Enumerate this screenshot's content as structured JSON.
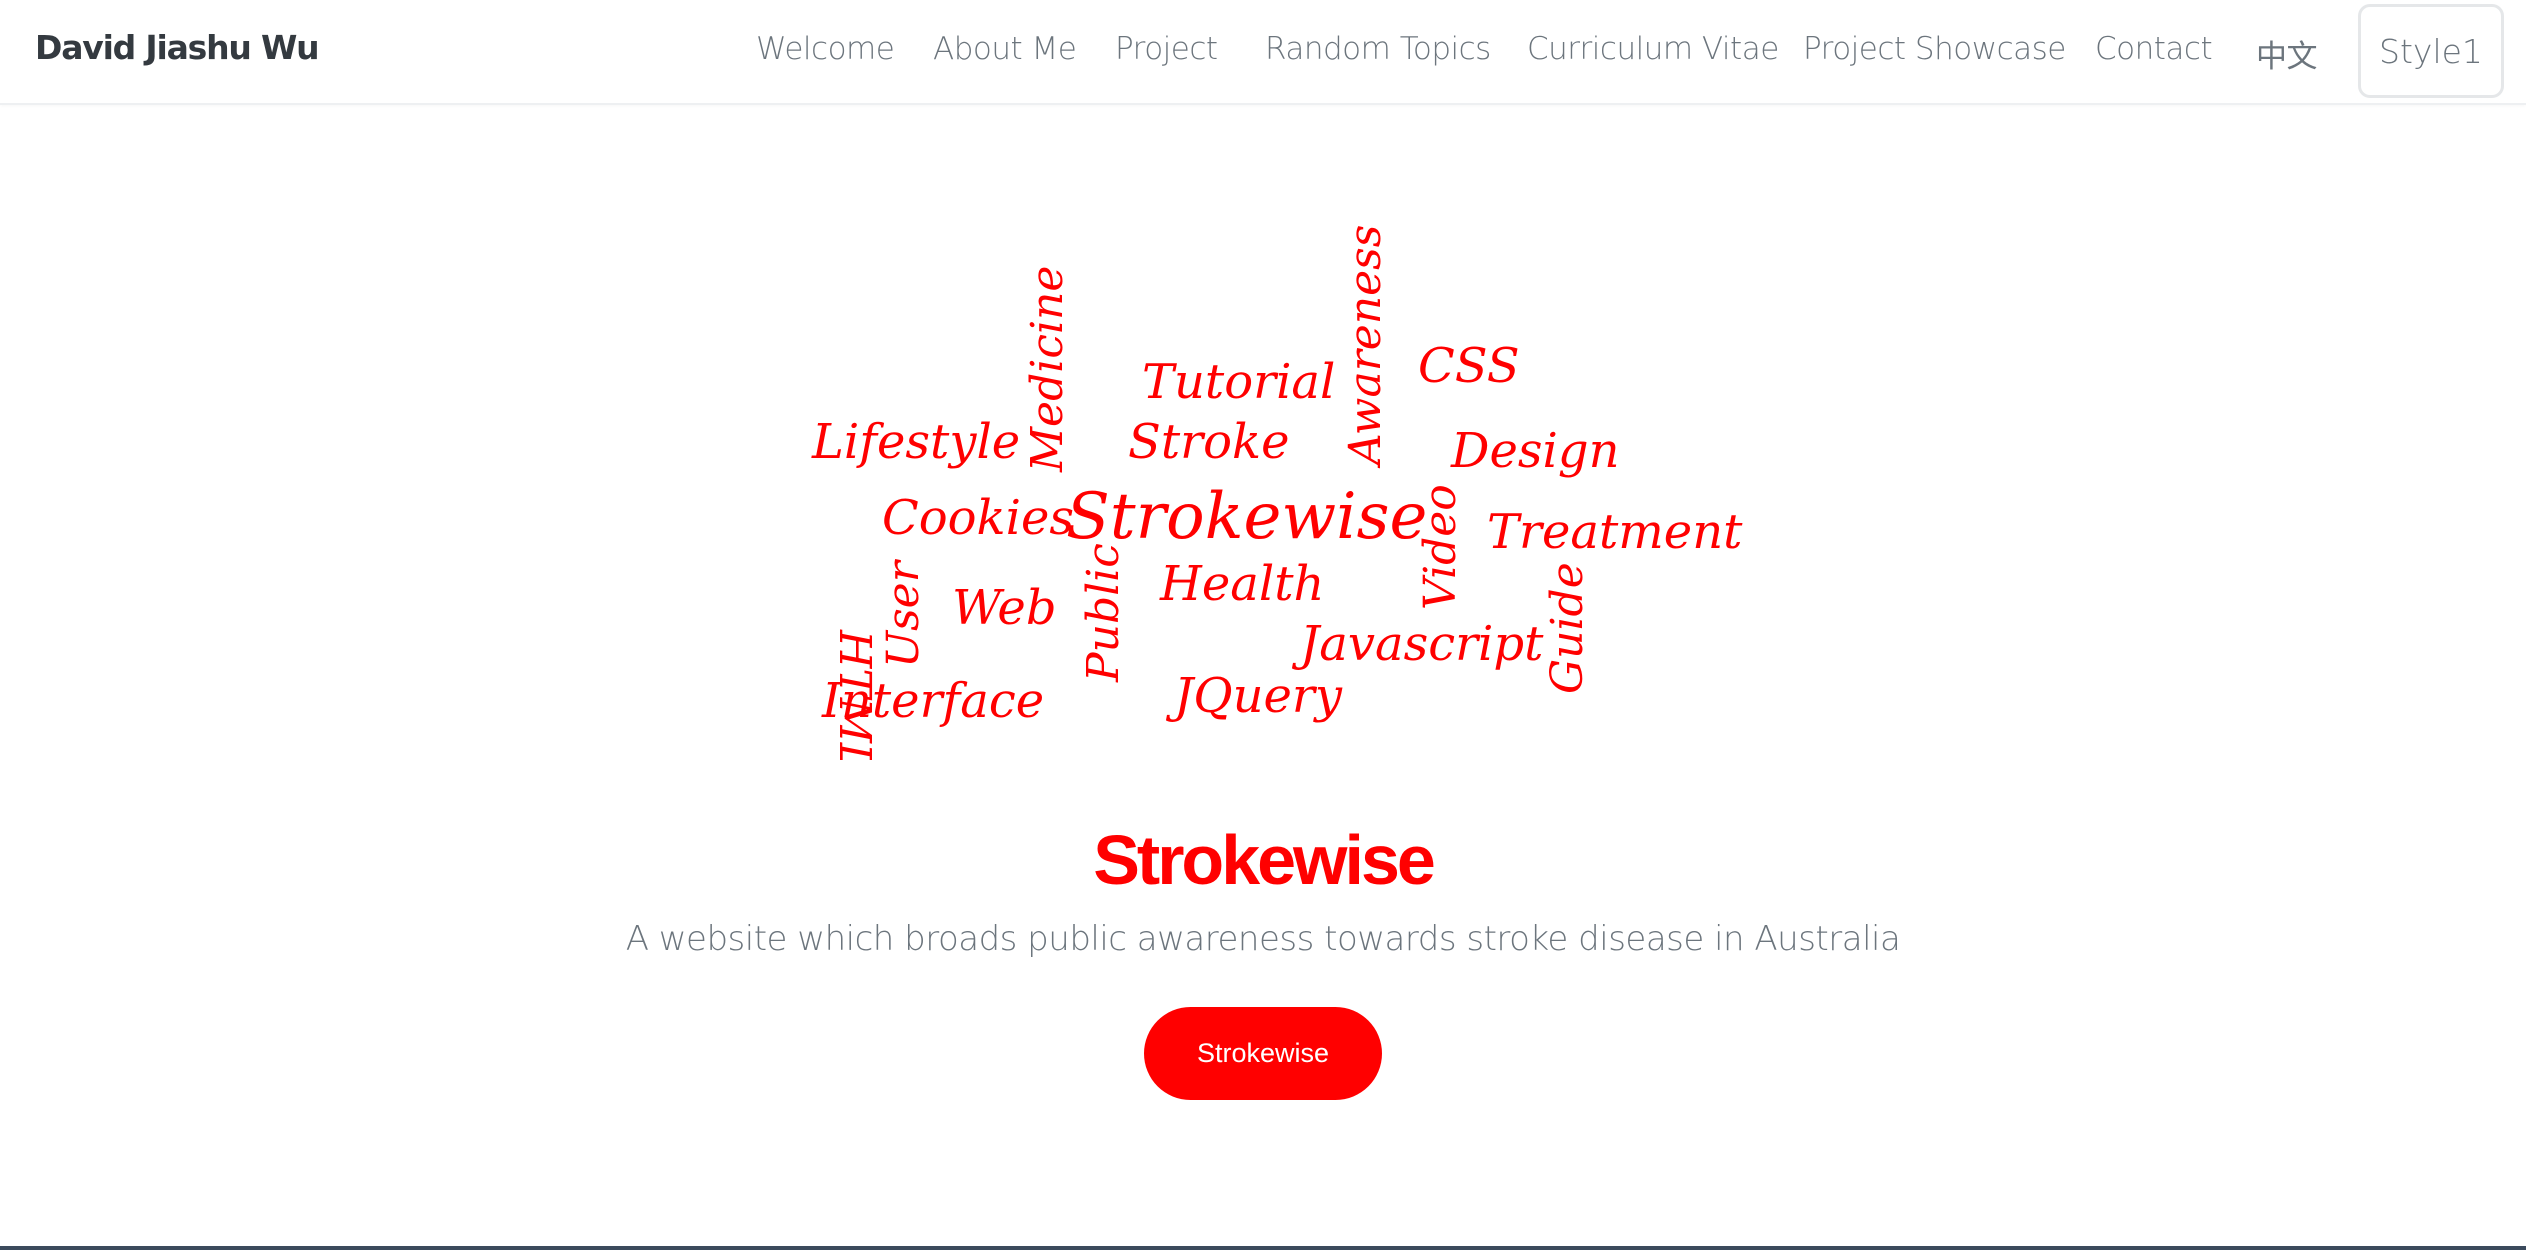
{
  "navbar": {
    "brand": "David Jiashu Wu",
    "links": [
      "Welcome",
      "About Me",
      "Project",
      "Random Topics",
      "Curriculum Vitae",
      "Project Showcase",
      "Contact",
      "中文"
    ],
    "style_button": "Style1"
  },
  "word_cloud": {
    "color": "#ff0000",
    "words": [
      "Lifestyle",
      "Medicine",
      "Tutorial",
      "Awareness",
      "CSS",
      "Stroke",
      "Design",
      "Cookies",
      "Strokewise",
      "Video",
      "Treatment",
      "HTML",
      "User",
      "Web",
      "Public",
      "Health",
      "Javascript",
      "Guide",
      "Interface",
      "JQuery"
    ]
  },
  "hero": {
    "title": "Strokewise",
    "subtitle": "A website which broads public awareness towards stroke disease in Australia",
    "button": "Strokewise",
    "accent_color": "#ff0000"
  }
}
